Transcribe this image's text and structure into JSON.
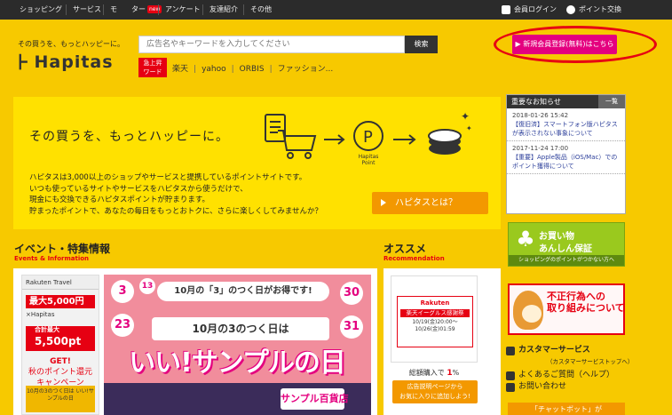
{
  "topnav": {
    "items": [
      "ショッピング",
      "サービス",
      "モ　　ター",
      "アンケート",
      "友達紹介",
      "その他"
    ],
    "new_badge": "new",
    "login": "会員ログイン",
    "point_exchange": "ポイント交換"
  },
  "header": {
    "tagline": "その買うを、もっとハッピーに。",
    "logo_mark": "⊦",
    "logo_text": "Hapitas",
    "search_placeholder": "広告名やキーワードを入力してください",
    "search_button": "検索",
    "hot_badge_line1": "急上昇",
    "hot_badge_line2": "ワード",
    "quick_links": [
      "楽天",
      "yahoo",
      "ORBIS",
      "ファッション..."
    ],
    "register_button": "▶ 新規会員登録(無料)はこちら"
  },
  "hero": {
    "tagline": "その買うを、もっとハッピーに。",
    "point_label_1": "Hapitas",
    "point_label_2": "Point",
    "desc": [
      "ハピタスは3,000以上のショップやサービスと提携しているポイントサイトです。",
      "いつも使っているサイトやサービスをハピタスから使うだけで、",
      "現金にも交換できるハピタスポイントが貯まります。",
      "貯まったポイントで、あなたの毎日をもっとおトクに、さらに楽しくしてみませんか？"
    ],
    "button": "ハピタスとは？"
  },
  "news": {
    "title": "重要なお知らせ",
    "more": "一覧",
    "items": [
      {
        "date": "2018-01-26 15:42",
        "text": "【復旧済】スマートフォン版ハピタスが表示されない事象について"
      },
      {
        "date": "2017-11-24 17:00",
        "text": "【重要】Apple製品（iOS/Mac）でのポイント獲得について"
      }
    ]
  },
  "sidebar": {
    "shop_line1": "お買い物",
    "shop_line2": "あんしん保証",
    "shop_sub": "ショッピングのポイントがつかない方へ",
    "fraud_line1": "不正行為への",
    "fraud_line2": "取り組みについて",
    "customer_service": "カスタマーサービス",
    "customer_service_sub": "（カスタマーサービストップへ）",
    "faq": "よくあるご質問（ヘルプ）",
    "contact": "お問い合わせ",
    "chatbot": "「チャットボット」が"
  },
  "events": {
    "title": "イベント・特集情報",
    "subtitle": "Events & Information",
    "rakuten": {
      "head": "Rakuten Travel",
      "amount": "最大5,000円",
      "hapitas": "×Hapitas",
      "points": "5,500pt",
      "points_label": "合計最大",
      "get": "GET!",
      "campaign_1": "秋のポイント還元",
      "campaign_2": "キャンペーン",
      "bottom": "10月の3のつく日は いい!サンプルの日"
    },
    "banner": {
      "headline": "10月の「3」のつく日がお得です!",
      "mid": "10月の3のつく日は",
      "big": "いい!サンプルの日",
      "num_3": "3",
      "num_13": "13",
      "num_23": "23",
      "num_30": "30",
      "num_31": "31",
      "dept": "サンプル百貨店"
    }
  },
  "recommend": {
    "title": "オススメ",
    "subtitle": "Recommendation",
    "brand": "Rakuten",
    "card_title": "楽天イーグルス感謝祭",
    "dates_1": "10/19(金)20:00〜",
    "dates_2": "10/26(金)01:59",
    "rate_label": "総額購入で",
    "rate": "1",
    "rate_unit": "%",
    "fav_line1": "広告説明ページから",
    "fav_line2": "お気に入りに追加しよう!"
  }
}
